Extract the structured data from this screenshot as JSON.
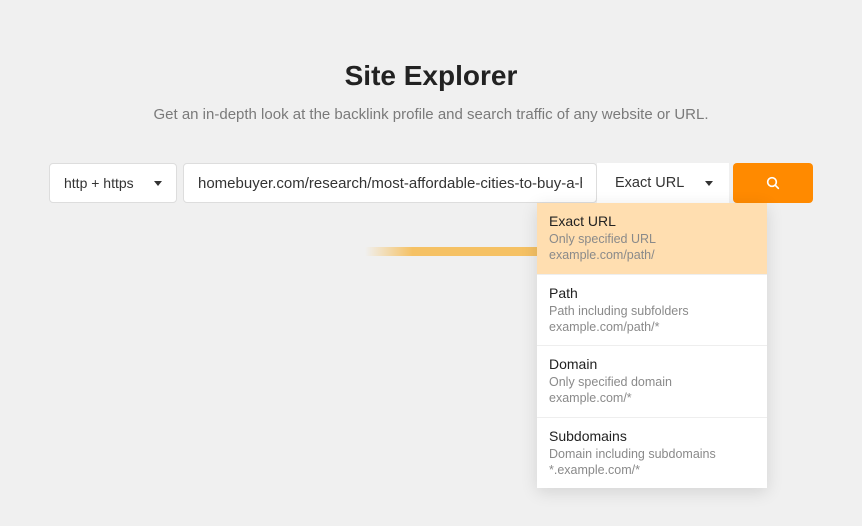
{
  "header": {
    "title": "Site Explorer",
    "subtitle": "Get an in-depth look at the backlink profile and search traffic of any website or URL."
  },
  "search": {
    "protocol_label": "http + https",
    "url_value": "homebuyer.com/research/most-affordable-cities-to-buy-a-home",
    "mode_label": "Exact URL"
  },
  "dropdown": {
    "items": [
      {
        "title": "Exact URL",
        "desc_line1": "Only specified URL",
        "desc_line2": "example.com/path/",
        "selected": true
      },
      {
        "title": "Path",
        "desc_line1": "Path including subfolders",
        "desc_line2": "example.com/path/*",
        "selected": false
      },
      {
        "title": "Domain",
        "desc_line1": "Only specified domain",
        "desc_line2": "example.com/*",
        "selected": false
      },
      {
        "title": "Subdomains",
        "desc_line1": "Domain including subdomains",
        "desc_line2": "*.example.com/*",
        "selected": false
      }
    ]
  },
  "colors": {
    "accent": "#ff8a00",
    "highlight": "#ffdeb0",
    "arrow": "#f5c164"
  }
}
